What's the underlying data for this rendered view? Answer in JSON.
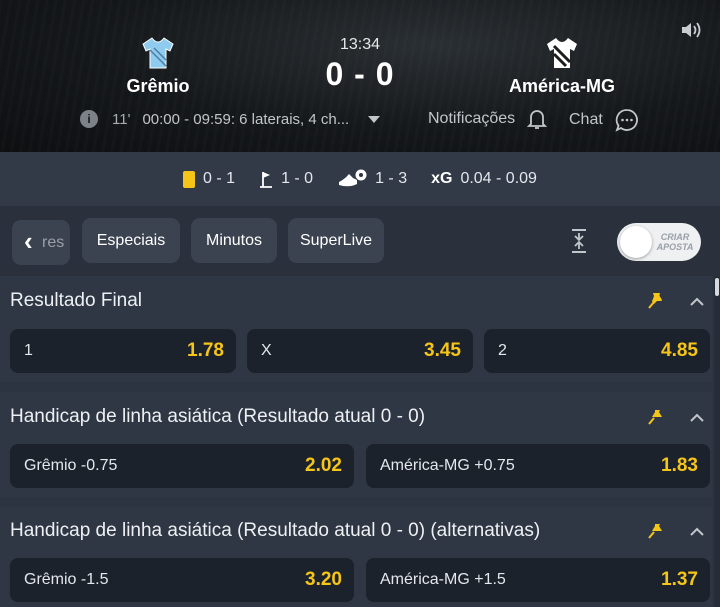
{
  "match": {
    "home": "Grêmio",
    "away": "América-MG",
    "time": "13:34",
    "score": "0 - 0",
    "minute": "11'",
    "event_text": "00:00 - 09:59: 6 laterais, 4 ch...",
    "notifications_label": "Notificações",
    "chat_label": "Chat",
    "colors": {
      "home_shirt": "#8ecbef",
      "away_shirt": "#ffffff"
    }
  },
  "stats": {
    "cards": "0 - 1",
    "corners": "1 - 0",
    "attacks": "1 - 3",
    "xg_label": "xG",
    "xg": "0.04 - 0.09"
  },
  "tabs": {
    "back_partial": "res",
    "items": [
      "Especiais",
      "Minutos",
      "SuperLive"
    ],
    "toggle_label_1": "CRIAR",
    "toggle_label_2": "APOSTA"
  },
  "markets": [
    {
      "title": "Resultado Final",
      "odds": [
        {
          "label": "1",
          "value": "1.78"
        },
        {
          "label": "X",
          "value": "3.45"
        },
        {
          "label": "2",
          "value": "4.85"
        }
      ]
    },
    {
      "title": "Handicap de linha asiática (Resultado atual 0 - 0)",
      "odds": [
        {
          "label": "Grêmio -0.75",
          "value": "2.02"
        },
        {
          "label": "América-MG +0.75",
          "value": "1.83"
        }
      ]
    },
    {
      "title": "Handicap de linha asiática (Resultado atual 0 - 0) (alternativas)",
      "odds": [
        {
          "label": "Grêmio -1.5",
          "value": "3.20"
        },
        {
          "label": "América-MG +1.5",
          "value": "1.37"
        }
      ]
    }
  ],
  "theme": {
    "accent": "#f5c518",
    "background": "#2c3441"
  }
}
